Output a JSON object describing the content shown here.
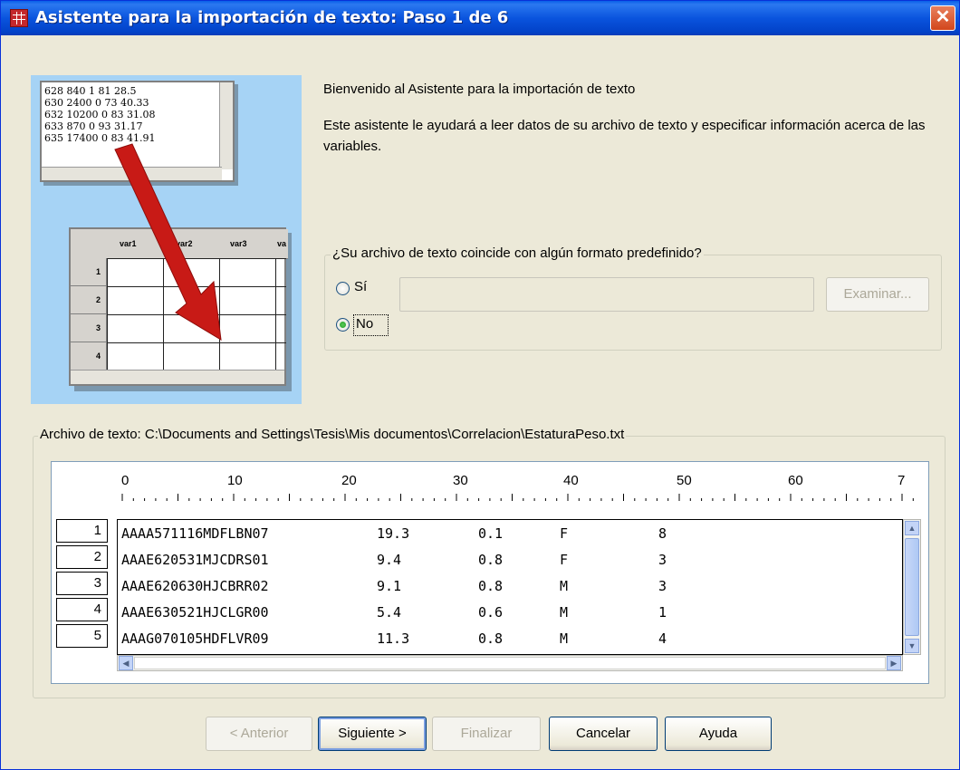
{
  "window": {
    "title": "Asistente para la importación de texto: Paso 1 de 6",
    "close_glyph": "✕"
  },
  "illustration": {
    "text_lines": [
      "628 840 1 81 28.5",
      "630 2400 0 73 40.33",
      "632 10200 0 83 31.08",
      "633 870 0 93 31.17",
      "635 17400 0 83 41.91"
    ],
    "grid_headers": [
      "var1",
      "var2",
      "var3",
      "va"
    ],
    "grid_rows": [
      "1",
      "2",
      "3",
      "4"
    ]
  },
  "intro": {
    "welcome": "Bienvenido al Asistente para la importación de texto",
    "description": "Este asistente le ayudará a leer datos de su archivo de texto y especificar información acerca de las variables."
  },
  "format_group": {
    "legend": "¿Su archivo de texto coincide con algún formato predefinido?",
    "option_yes": "Sí",
    "option_no": "No",
    "selected": "No",
    "path_value": "",
    "browse_label": "Examinar..."
  },
  "file_group": {
    "legend": "Archivo de texto:  C:\\Documents and Settings\\Tesis\\Mis documentos\\Correlacion\\EstaturaPeso.txt",
    "ruler": [
      "0",
      "10",
      "20",
      "30",
      "40",
      "50",
      "60",
      "7"
    ],
    "rows": [
      {
        "num": "1",
        "cols": [
          "AAAA571116MDFLBN07",
          "19.3",
          "0.1",
          "F",
          "8"
        ]
      },
      {
        "num": "2",
        "cols": [
          "AAAE620531MJCDRS01",
          "9.4",
          "0.8",
          "F",
          "3"
        ]
      },
      {
        "num": "3",
        "cols": [
          "AAAE620630HJCBRR02",
          "9.1",
          "0.8",
          "M",
          "3"
        ]
      },
      {
        "num": "4",
        "cols": [
          "AAAE630521HJCLGR00",
          "5.4",
          "0.6",
          "M",
          "1"
        ]
      },
      {
        "num": "5",
        "cols": [
          "AAAG070105HDFLVR09",
          "11.3",
          "0.8",
          "M",
          "4"
        ]
      }
    ]
  },
  "buttons": {
    "back": "< Anterior",
    "next": "Siguiente >",
    "finish": "Finalizar",
    "cancel": "Cancelar",
    "help": "Ayuda"
  }
}
